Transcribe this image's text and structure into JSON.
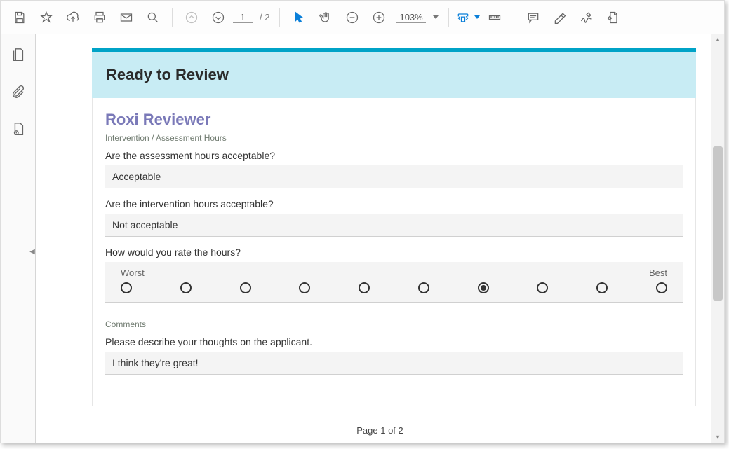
{
  "toolbar": {
    "page_current": "1",
    "page_total": "/ 2",
    "zoom": "103%"
  },
  "form": {
    "header_title": "Ready to Review",
    "reviewer_name": "Roxi Reviewer",
    "section1_label": "Intervention / Assessment Hours",
    "q1": "Are the assessment hours acceptable?",
    "a1": "Acceptable",
    "q2": "Are the intervention hours acceptable?",
    "a2": "Not acceptable",
    "q3": "How would you rate the hours?",
    "rating_worst": "Worst",
    "rating_best": "Best",
    "rating_selected_index": 6,
    "rating_count": 10,
    "comments_label": "Comments",
    "q4": "Please describe your thoughts on the applicant.",
    "a4": "I think they're great!"
  },
  "footer": {
    "page_label": "Page 1 of 2"
  }
}
